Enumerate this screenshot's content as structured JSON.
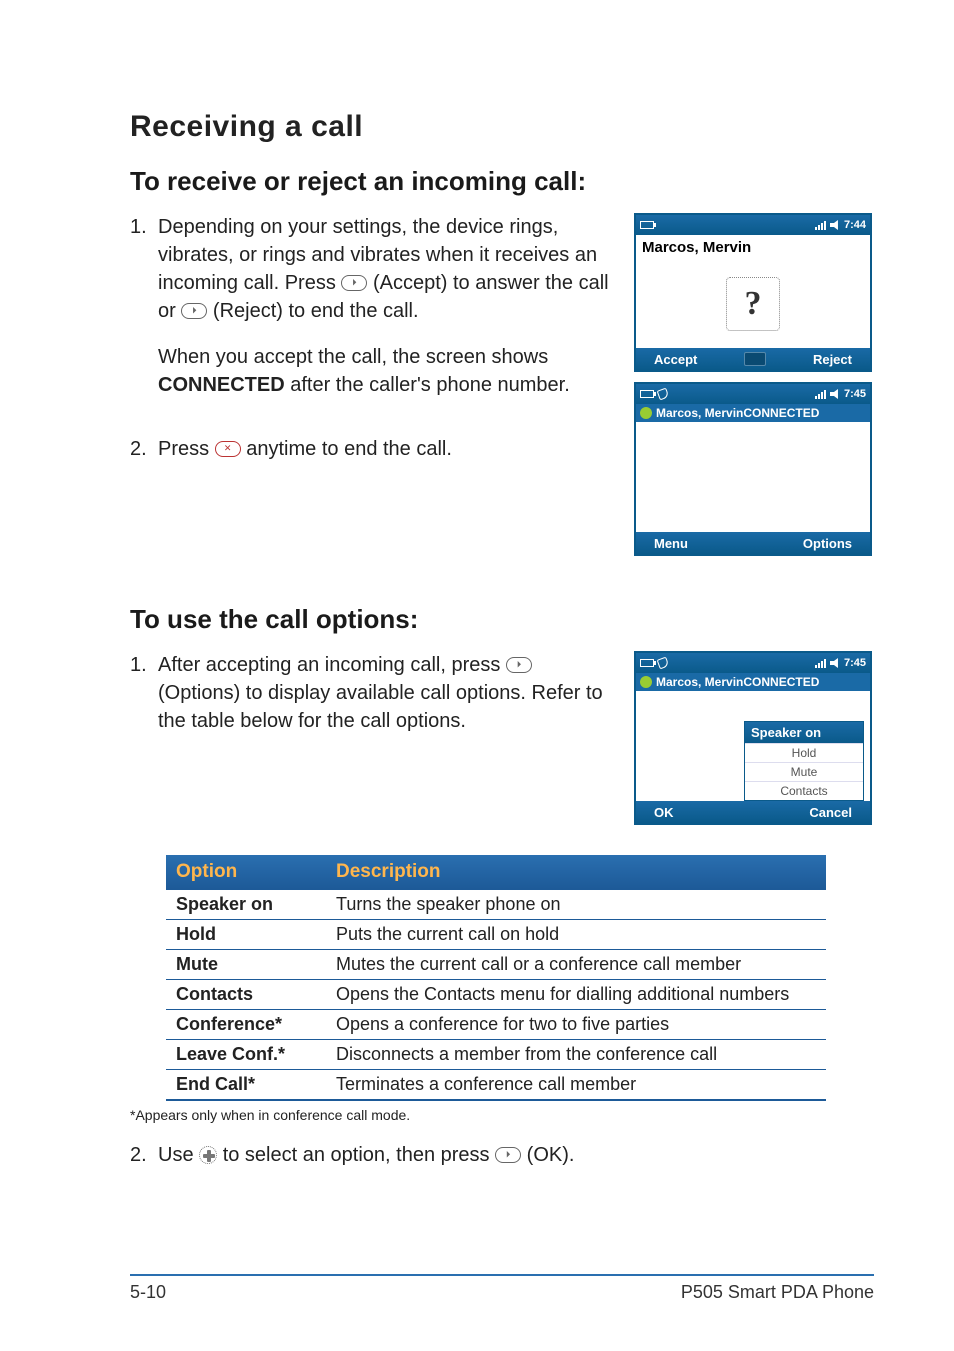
{
  "headings": {
    "h1": "Receiving a call",
    "h2a": "To receive or reject an incoming call:",
    "h2b": "To use the call options:"
  },
  "sectionA": {
    "step1_num": "1.",
    "step1_p1_a": "Depending on your settings, the device rings, vibrates, or rings and vibrates when it receives an incoming call. Press ",
    "step1_p1_b": " (Accept) to answer the call or ",
    "step1_p1_c": " (Reject) to end the call.",
    "step1_p2_a": "When you accept the call, the screen shows ",
    "step1_p2_bold": "CONNECTED",
    "step1_p2_b": " after the caller's phone number.",
    "step2_num": "2.",
    "step2_a": "Press ",
    "step2_b": " anytime to end the call."
  },
  "sectionB": {
    "step1_num": "1.",
    "step1_a": "After accepting an incoming call, press ",
    "step1_b": " (Options) to display available call options. Refer to the table below for the call options."
  },
  "phone1": {
    "time": "7:44",
    "title": "Marcos, Mervin",
    "left": "Accept",
    "right": "Reject"
  },
  "phone2": {
    "time": "7:45",
    "conn": "Marcos, MervinCONNECTED",
    "left": "Menu",
    "right": "Options"
  },
  "phone3": {
    "time": "7:45",
    "conn": "Marcos, MervinCONNECTED",
    "popup_hd": "Speaker on",
    "popup_items": [
      "Hold",
      "Mute",
      "Contacts"
    ],
    "left": "OK",
    "right": "Cancel"
  },
  "table": {
    "h_option": "Option",
    "h_desc": "Description",
    "rows": [
      {
        "o": "Speaker on",
        "d": "Turns the speaker phone on"
      },
      {
        "o": "Hold",
        "d": "Puts the current call on hold"
      },
      {
        "o": "Mute",
        "d": "Mutes the current call or a conference call member"
      },
      {
        "o": "Contacts",
        "d": "Opens the Contacts menu for dialling additional numbers"
      },
      {
        "o": "Conference*",
        "d": "Opens a conference for two to five parties"
      },
      {
        "o": "Leave Conf.*",
        "d": "Disconnects a member from the conference call"
      },
      {
        "o": "End Call*",
        "d": "Terminates a conference call member"
      }
    ],
    "note": "*Appears only when in conference call mode."
  },
  "step_final": {
    "num": "2.",
    "a": "Use ",
    "b": " to select an option, then press ",
    "c": " (OK)."
  },
  "footer": {
    "left": "5-10",
    "right": "P505 Smart PDA Phone"
  }
}
